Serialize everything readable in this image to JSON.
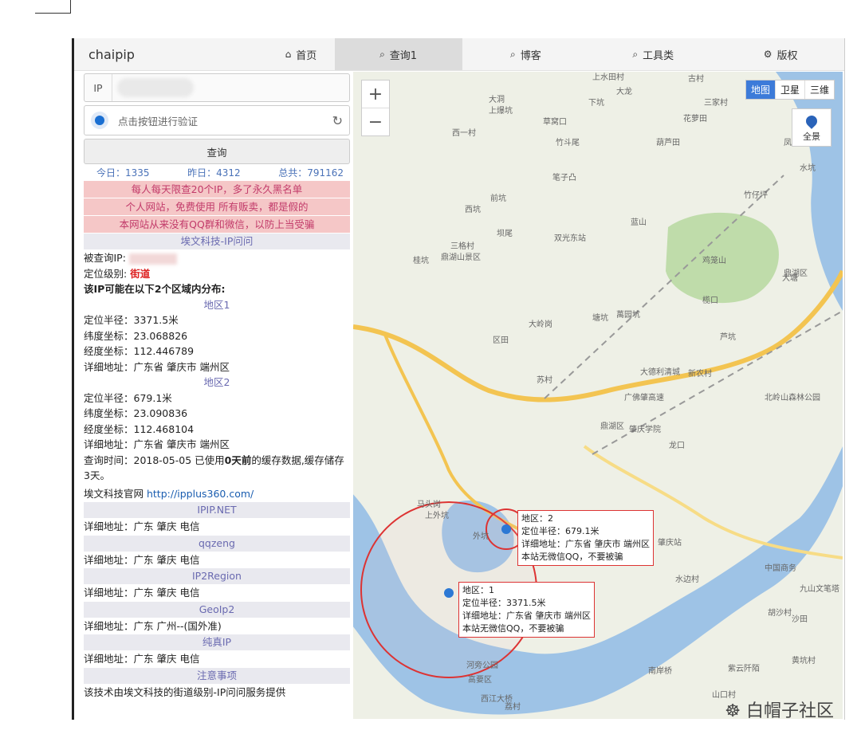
{
  "nav": {
    "brand": "chaipip",
    "items": [
      {
        "label": "首页",
        "icon": "home-icon",
        "glyph": "⌂"
      },
      {
        "label": "查询1",
        "icon": "search-icon",
        "glyph": "⌕"
      },
      {
        "label": "博客",
        "icon": "search-icon",
        "glyph": "⌕"
      },
      {
        "label": "工具类",
        "icon": "search-icon",
        "glyph": "⌕"
      },
      {
        "label": "版权",
        "icon": "gear-icon",
        "glyph": "⚙"
      }
    ]
  },
  "form": {
    "ip_label": "IP",
    "captcha_text": "点击按钮进行验证",
    "query_button": "查询"
  },
  "stats": {
    "today": "今日：1335",
    "yesterday": "昨日：4312",
    "total": "总共：791162"
  },
  "warnings": [
    "每人每天限查20个IP，多了永久黑名单",
    "个人网站，免费使用 所有贩卖，都是假的",
    "本网站从来没有QQ群和微信，以防上当受骗"
  ],
  "provider_title": "埃文科技-IP问问",
  "result": {
    "queried_ip_label": "被查询IP:",
    "level_label": "定位级别:",
    "level_value": "街道",
    "summary": "该IP可能在以下2个区域内分布:",
    "areas": [
      {
        "title": "地区1",
        "radius": "定位半径：3371.5米",
        "lat": "纬度坐标：23.068826",
        "lng": "经度坐标：112.446789",
        "addr": "详细地址：广东省 肇庆市 端州区"
      },
      {
        "title": "地区2",
        "radius": "定位半径：679.1米",
        "lat": "纬度坐标：23.090836",
        "lng": "经度坐标：112.468104",
        "addr": "详细地址：广东省 肇庆市 端州区"
      }
    ],
    "query_time_a": "查询时间：2018-05-05 已使用",
    "query_time_b": "0天前",
    "query_time_c": "的缓存数据,缓存储存",
    "query_time_d": "3天。",
    "official_label": "埃文科技官网 ",
    "official_link": "http://ipplus360.com/"
  },
  "sources": [
    {
      "title": "IPIP.NET",
      "addr": "详细地址：广东 肇庆 电信"
    },
    {
      "title": "qqzeng",
      "addr": "详细地址：广东 肇庆 电信"
    },
    {
      "title": "IP2Region",
      "addr": "详细地址：广东 肇庆 电信"
    },
    {
      "title": "GeoIp2",
      "addr": "详细地址：广东 广州--(国外准)"
    },
    {
      "title": "纯真IP",
      "addr": "详细地址：广东 肇庆 电信"
    }
  ],
  "notice_title": "注意事项",
  "notice_text": "该技术由埃文科技的街道级别-IP问问服务提供",
  "map": {
    "zoom_in": "+",
    "zoom_out": "−",
    "types": [
      "地图",
      "卫星",
      "三维"
    ],
    "panorama": "全景",
    "popup2": {
      "area": "地区：2",
      "radius": "定位半径：679.1米",
      "addr": "详细地址：广东省 肇庆市 端州区",
      "note": "本站无微信QQ，不要被骗"
    },
    "popup1": {
      "area": "地区：1",
      "radius": "定位半径：3371.5米",
      "addr": "详细地址：广东省 肇庆市 端州区",
      "note": "本站无微信QQ，不要被骗"
    },
    "labels": [
      "上水田村",
      "古村",
      "大龙",
      "三家村",
      "大洞",
      "下坑",
      "花萝田",
      "上爆坑",
      "草窝口",
      "西一村",
      "竹斗尾",
      "葫芦田",
      "凤凰",
      "水坑",
      "笔子凸",
      "竹仔坪",
      "前坑",
      "蓝山",
      "西坑",
      "坝尾",
      "双光东站",
      "三格村",
      "鸡笼山",
      "鼎湖山景区",
      "桂坑",
      "榄口",
      "塘坑",
      "萬园坑",
      "鼎湖区",
      "大岭岗",
      "区田",
      "芦坑",
      "大德利清城",
      "新农村",
      "苏村",
      "广佛肇高速",
      "北岭山森林公园",
      "龙口",
      "大塘",
      "鼎湖区",
      "肇庆学院",
      "马头岗",
      "上外坑",
      "外坑",
      "肇庆站",
      "中国商务",
      "水边村",
      "河旁公园",
      "西江大桥",
      "高要区",
      "南岸桥",
      "紫云阡陌",
      "荔村",
      "山口村",
      "九山文笔塔",
      "沙田",
      "黄坑村",
      "胡沙村"
    ],
    "watermark": "白帽子社区"
  }
}
